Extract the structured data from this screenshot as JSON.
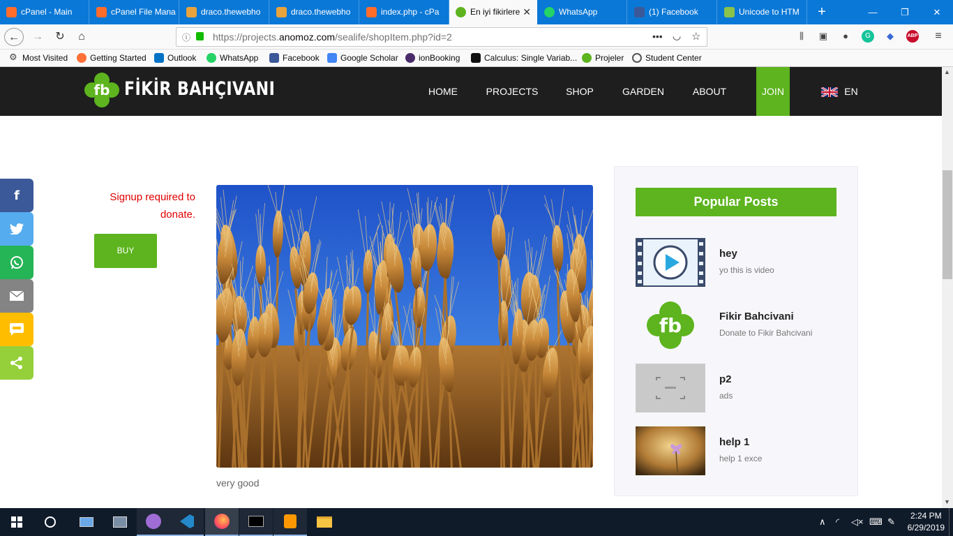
{
  "browser": {
    "tabs": [
      {
        "label": "cPanel - Main",
        "icon": "cpanel-icon"
      },
      {
        "label": "cPanel File Mana",
        "icon": "cpanel-icon"
      },
      {
        "label": "draco.thewebho",
        "icon": "server-icon"
      },
      {
        "label": "draco.thewebho",
        "icon": "server-icon"
      },
      {
        "label": "index.php - cPa",
        "icon": "cpanel-icon"
      },
      {
        "label": "En iyi fikirlere",
        "icon": "fb-logo-icon",
        "active": true
      },
      {
        "label": "WhatsApp",
        "icon": "whatsapp-icon"
      },
      {
        "label": "(1) Facebook",
        "icon": "facebook-icon"
      },
      {
        "label": "Unicode to HTM",
        "icon": "unicode-icon"
      }
    ],
    "url_prefix": "https://projects.",
    "url_domain": "anomoz.com",
    "url_path": "/sealife/shopItem.php?id=2",
    "bookmarks": [
      {
        "label": "Most Visited",
        "icon": "gear-icon"
      },
      {
        "label": "Getting Started",
        "icon": "firefox-icon"
      },
      {
        "label": "Outlook",
        "icon": "outlook-icon"
      },
      {
        "label": "WhatsApp",
        "icon": "whatsapp-icon"
      },
      {
        "label": "Facebook",
        "icon": "facebook-icon"
      },
      {
        "label": "Google Scholar",
        "icon": "scholar-icon"
      },
      {
        "label": "ionBooking",
        "icon": "ion-icon"
      },
      {
        "label": "Calculus: Single Variab...",
        "icon": "s-icon"
      },
      {
        "label": "Projeler",
        "icon": "fb-logo-icon"
      },
      {
        "label": "Student Center",
        "icon": "globe-icon"
      }
    ]
  },
  "site": {
    "logo_text": "FİKİR BAHÇIVANI",
    "menu": [
      "HOME",
      "PROJECTS",
      "SHOP",
      "GARDEN",
      "ABOUT",
      "JOIN"
    ],
    "language": "EN",
    "accent": "#5db41e"
  },
  "product": {
    "signup_text": "Signup required to donate.",
    "buy_label": "BUY",
    "caption": "very good"
  },
  "sidebar": {
    "title": "Popular Posts",
    "posts": [
      {
        "title": "hey",
        "subtitle": "yo this is video"
      },
      {
        "title": "Fikir Bahcivani",
        "subtitle": "Donate to Fikir Bahcivani"
      },
      {
        "title": "p2",
        "subtitle": "ads"
      },
      {
        "title": "help 1",
        "subtitle": "help 1 exce"
      }
    ]
  },
  "share": [
    "facebook-icon",
    "twitter-icon",
    "whatsapp-icon",
    "email-icon",
    "sms-icon",
    "share-icon"
  ],
  "taskbar": {
    "time": "2:24 PM",
    "date": "6/29/2019"
  }
}
